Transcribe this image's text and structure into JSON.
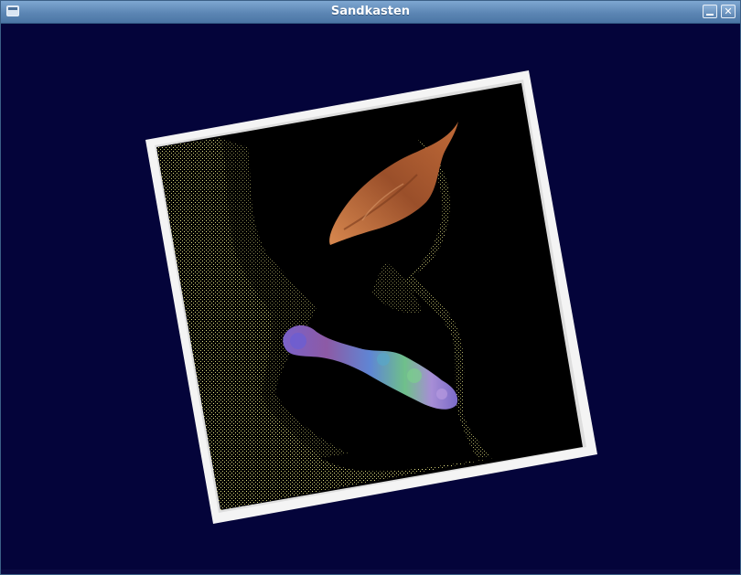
{
  "window": {
    "title": "Sandkasten"
  },
  "icons": {
    "menu": "window-menu-icon",
    "minimize": "minimize-icon",
    "close": "close-icon"
  },
  "colors": {
    "background": "#04043a",
    "titlebar": "#5c86b4",
    "frame": "#f4f4f4",
    "pit": "#000000",
    "sand_dots": "#e8e68a"
  }
}
